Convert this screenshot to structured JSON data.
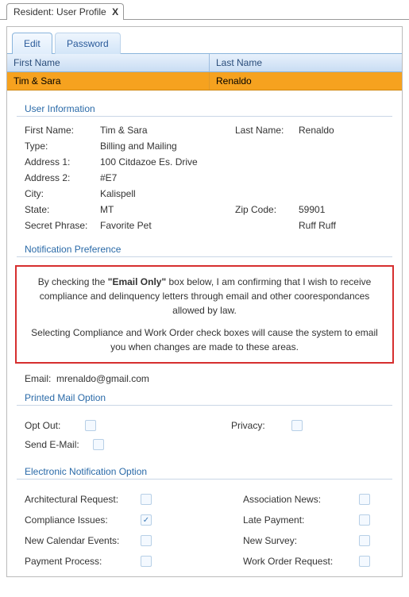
{
  "window": {
    "title": "Resident: User Profile",
    "close": "X"
  },
  "tabs": {
    "edit": "Edit",
    "password": "Password"
  },
  "grid": {
    "headers": {
      "first": "First Name",
      "last": "Last Name"
    },
    "row": {
      "first": "Tim & Sara",
      "last": "Renaldo"
    }
  },
  "sections": {
    "user_info": "User Information",
    "notif_pref": "Notification Preference",
    "printed_mail": "Printed Mail Option",
    "electronic": "Electronic Notification Option"
  },
  "info": {
    "first_name_lbl": "First Name:",
    "first_name": "Tim & Sara",
    "last_name_lbl": "Last Name:",
    "last_name": "Renaldo",
    "type_lbl": "Type:",
    "type": "Billing and Mailing",
    "addr1_lbl": "Address 1:",
    "addr1": "100 Citdazoe Es. Drive",
    "addr2_lbl": "Address 2:",
    "addr2": "#E7",
    "city_lbl": "City:",
    "city": "Kalispell",
    "state_lbl": "State:",
    "state": "MT",
    "zip_lbl": "Zip Code:",
    "zip": "59901",
    "secret_lbl": "Secret Phrase:",
    "secret": "Favorite Pet",
    "secret_val": "Ruff Ruff"
  },
  "notice": {
    "part1": "By checking the ",
    "email_only": "\"Email Only\"",
    "part2": " box below, I am confirming that I wish to receive compliance and delinquency letters through email and other coorespondances allowed by law.",
    "part3": "Selecting Compliance and Work Order check boxes will cause the system to email you when changes are made to these areas."
  },
  "email_line": {
    "lbl": "Email:",
    "val": "mrenaldo@gmail.com"
  },
  "mail_opts": {
    "opt_out": "Opt Out:",
    "privacy": "Privacy:",
    "send_email": "Send E-Mail:"
  },
  "electronic_opts": {
    "arch": "Architectural Request:",
    "assoc_news": "Association News:",
    "compliance": "Compliance Issues:",
    "late_pay": "Late Payment:",
    "calendar": "New Calendar Events:",
    "survey": "New Survey:",
    "payment": "Payment Process:",
    "work_order": "Work Order Request:"
  },
  "checks": {
    "opt_out": false,
    "privacy": false,
    "send_email": false,
    "arch": false,
    "assoc_news": false,
    "compliance": true,
    "late_pay": false,
    "calendar": false,
    "survey": false,
    "payment": false,
    "work_order": false
  },
  "glyphs": {
    "check": "✓"
  }
}
